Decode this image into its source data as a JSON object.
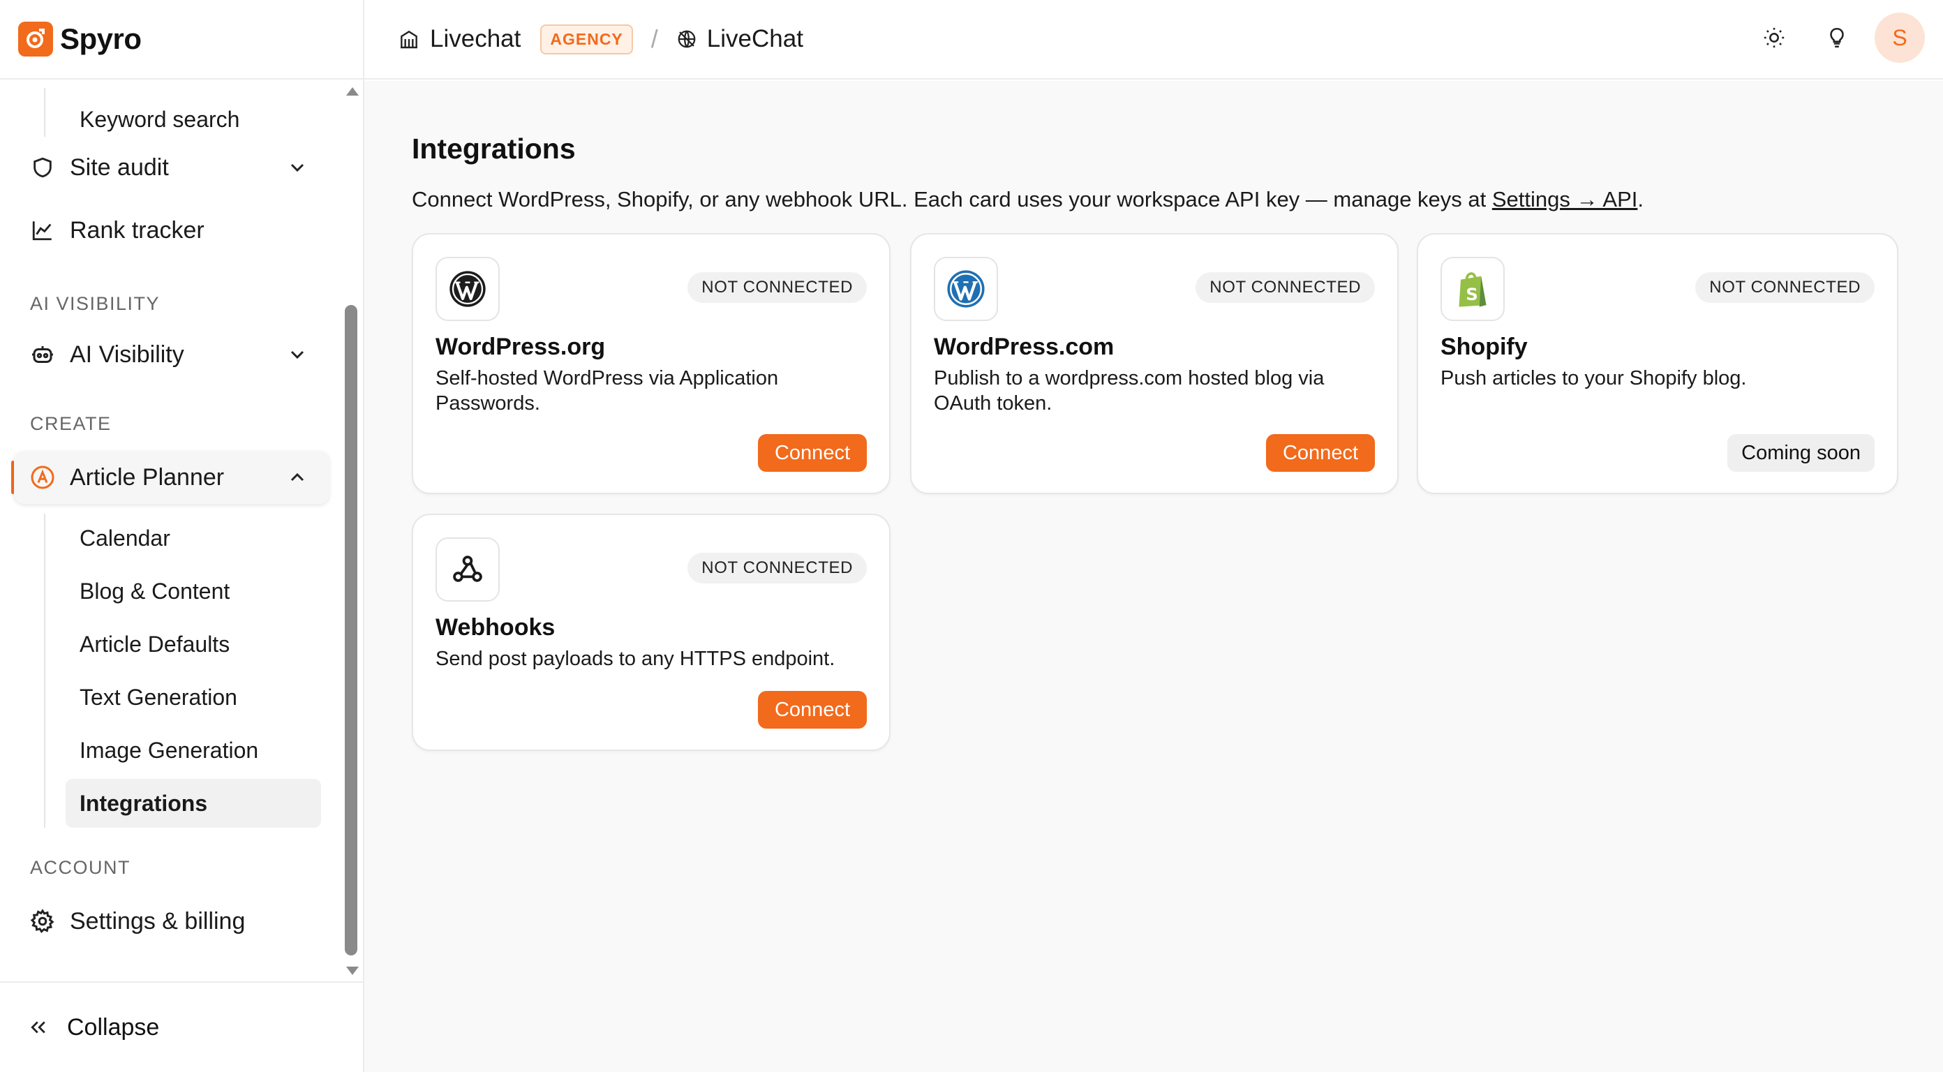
{
  "brand": {
    "name": "Spyro",
    "accent": "#f26a1b"
  },
  "sidebar": {
    "top_items": [
      {
        "label": "Keyword search"
      },
      {
        "label": "Site audit",
        "icon": "shield-icon"
      },
      {
        "label": "Rank tracker",
        "icon": "chart-line-icon"
      }
    ],
    "sections": {
      "ai_visibility": "AI VISIBILITY",
      "create": "CREATE",
      "account": "ACCOUNT"
    },
    "ai_visibility_item": {
      "label": "AI Visibility",
      "icon": "robot-icon"
    },
    "article_planner": {
      "label": "Article Planner",
      "icon": "article-planner-icon"
    },
    "sub_items": [
      {
        "label": "Calendar"
      },
      {
        "label": "Blog & Content"
      },
      {
        "label": "Article Defaults"
      },
      {
        "label": "Text Generation"
      },
      {
        "label": "Image Generation"
      },
      {
        "label": "Integrations"
      }
    ],
    "settings_item": {
      "label": "Settings & billing",
      "icon": "gear-icon"
    },
    "collapse_label": "Collapse"
  },
  "header": {
    "workspace": "Livechat",
    "workspace_badge": "AGENCY",
    "separator": "/",
    "project": "LiveChat",
    "avatar_initial": "S"
  },
  "main": {
    "title": "Integrations",
    "description_prefix": "Connect WordPress, Shopify, or any webhook URL. Each card uses your workspace API key — manage keys at ",
    "description_link": "Settings → API",
    "description_suffix": ".",
    "cards": [
      {
        "icon": "wordpress-icon",
        "status": "NOT CONNECTED",
        "title": "WordPress.org",
        "description": "Self-hosted WordPress via Application Passwords.",
        "action": "Connect"
      },
      {
        "icon": "wordpress-com-icon",
        "status": "NOT CONNECTED",
        "title": "WordPress.com",
        "description": "Publish to a wordpress.com hosted blog via OAuth token.",
        "action": "Connect"
      },
      {
        "icon": "shopify-icon",
        "status": "NOT CONNECTED",
        "title": "Shopify",
        "description": "Push articles to your Shopify blog.",
        "action": "Coming soon"
      },
      {
        "icon": "webhook-icon",
        "status": "NOT CONNECTED",
        "title": "Webhooks",
        "description": "Send post payloads to any HTTPS endpoint.",
        "action": "Connect"
      }
    ]
  }
}
